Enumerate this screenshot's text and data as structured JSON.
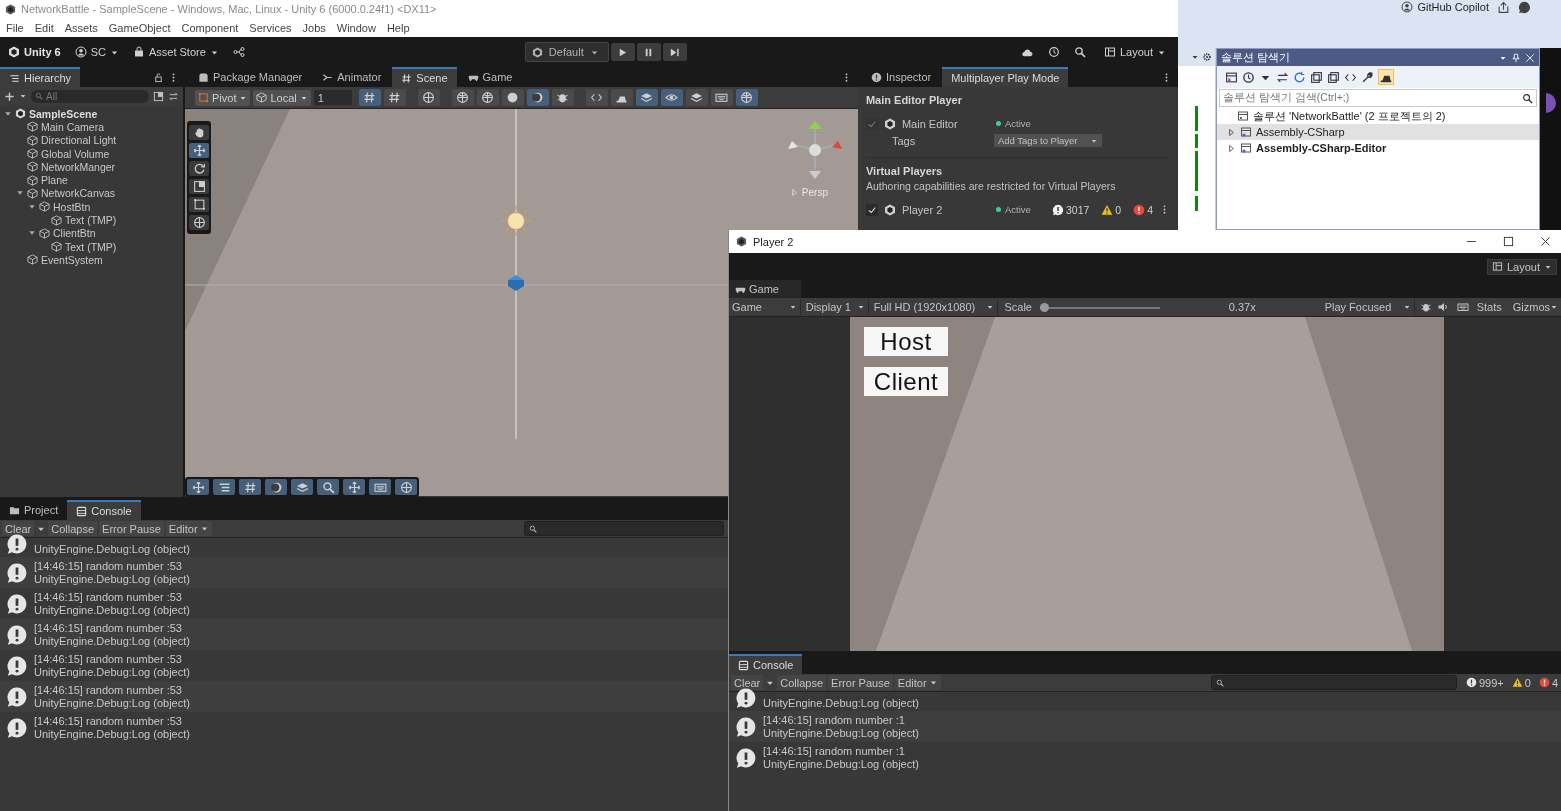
{
  "editor": {
    "title": "NetworkBattle - SampleScene - Windows, Mac, Linux - Unity 6 (6000.0.24f1) <DX11>",
    "menu": [
      "File",
      "Edit",
      "Assets",
      "GameObject",
      "Component",
      "Services",
      "Jobs",
      "Window",
      "Help"
    ],
    "toolbar": {
      "brand": "Unity 6",
      "account": "SC",
      "asset_store": "Asset Store",
      "play_mode": "Default",
      "layout": "Layout"
    },
    "hierarchy": {
      "tab": "Hierarchy",
      "search_placeholder": "All",
      "items": [
        {
          "label": "SampleScene",
          "kind": "scene",
          "expanded": true,
          "children": [
            {
              "label": "Main Camera",
              "kind": "object"
            },
            {
              "label": "Directional Light",
              "kind": "object"
            },
            {
              "label": "Global Volume",
              "kind": "object"
            },
            {
              "label": "NetworkManger",
              "kind": "object"
            },
            {
              "label": "Plane",
              "kind": "object"
            },
            {
              "label": "NetworkCanvas",
              "kind": "object",
              "expanded": true,
              "children": [
                {
                  "label": "HostBtn",
                  "kind": "object",
                  "expanded": true,
                  "children": [
                    {
                      "label": "Text (TMP)",
                      "kind": "object"
                    }
                  ]
                },
                {
                  "label": "ClientBtn",
                  "kind": "object",
                  "expanded": true,
                  "children": [
                    {
                      "label": "Text (TMP)",
                      "kind": "object"
                    }
                  ]
                }
              ]
            },
            {
              "label": "EventSystem",
              "kind": "object"
            }
          ]
        }
      ]
    },
    "center_tabs": [
      {
        "label": "Package Manager",
        "kind": "package",
        "selected": false
      },
      {
        "label": "Animator",
        "kind": "animator",
        "selected": false
      },
      {
        "label": "Scene",
        "kind": "scene",
        "selected": true
      },
      {
        "label": "Game",
        "kind": "game",
        "selected": false
      }
    ],
    "scene_toolbar": {
      "pivot": "Pivot",
      "space": "Local",
      "grid_size": "1"
    },
    "scene_view": {
      "projection": "Persp"
    },
    "inspector": {
      "tabs": [
        {
          "label": "Inspector",
          "kind": "inspector",
          "selected": false
        },
        {
          "label": "Multiplayer Play Mode",
          "kind": "plain",
          "selected": true
        }
      ],
      "main_heading": "Main Editor Player",
      "main_player": {
        "name": "Main Editor",
        "checked": true,
        "disabled": true,
        "status": "Active",
        "tags_label": "Tags",
        "tags_placeholder": "Add Tags to Player"
      },
      "virtual_heading": "Virtual Players",
      "virtual_note": "Authoring capabilities are restricted for Virtual Players",
      "virtual_players": [
        {
          "name": "Player 2",
          "checked": true,
          "disabled": false,
          "status": "Active",
          "logs": "3017",
          "warnings": "0",
          "errors": "4"
        }
      ]
    },
    "console": {
      "tabs": [
        {
          "label": "Project",
          "kind": "project",
          "selected": false
        },
        {
          "label": "Console",
          "kind": "console",
          "selected": true
        }
      ],
      "buttons": [
        {
          "label": "Clear",
          "kind": "split"
        },
        {
          "label": "Collapse",
          "kind": "toggle"
        },
        {
          "label": "Error Pause",
          "kind": "toggle"
        },
        {
          "label": "Editor",
          "kind": "dropdown"
        }
      ],
      "entries": [
        {
          "trace": "UnityEngine.Debug:Log (object)"
        },
        {
          "message": "[14:46:15] random number :53",
          "trace": "UnityEngine.Debug:Log (object)"
        },
        {
          "message": "[14:46:15] random number :53",
          "trace": "UnityEngine.Debug:Log (object)"
        },
        {
          "message": "[14:46:15] random number :53",
          "trace": "UnityEngine.Debug:Log (object)"
        },
        {
          "message": "[14:46:15] random number :53",
          "trace": "UnityEngine.Debug:Log (object)"
        },
        {
          "message": "[14:46:15] random number :53",
          "trace": "UnityEngine.Debug:Log (object)"
        },
        {
          "message": "[14:46:15] random number :53",
          "trace": "UnityEngine.Debug:Log (object)"
        }
      ]
    }
  },
  "solution_explorer": {
    "copilot": "GitHub Copilot",
    "title": "솔루션 탐색기",
    "search_placeholder": "솔루션 탐색기 검색(Ctrl+;)",
    "solution": "솔루션 'NetworkBattle'  (2 프로젝트의 2)",
    "projects": [
      {
        "label": "Assembly-CSharp",
        "selected": true,
        "startup": false
      },
      {
        "label": "Assembly-CSharp-Editor",
        "selected": false,
        "startup": true
      }
    ]
  },
  "player_window": {
    "title": "Player 2",
    "layout": "Layout",
    "tab": "Game",
    "toolbar": {
      "view": "Game",
      "display": "Display 1",
      "resolution": "Full HD (1920x1080)",
      "scale_label": "Scale",
      "scale": {
        "level": 0
      },
      "scale_value": "0.37x",
      "play_focus": "Play Focused",
      "stats": "Stats",
      "gizmos": "Gizmos"
    },
    "game_buttons": [
      "Host",
      "Client"
    ],
    "console": {
      "tabs": [
        {
          "label": "Console",
          "kind": "console",
          "selected": true
        }
      ],
      "buttons": [
        {
          "label": "Clear",
          "kind": "split"
        },
        {
          "label": "Collapse",
          "kind": "toggle"
        },
        {
          "label": "Error Pause",
          "kind": "toggle"
        },
        {
          "label": "Editor",
          "kind": "dropdown"
        }
      ],
      "counts": {
        "logs": "999+",
        "warnings": "0",
        "errors": "4"
      },
      "entries": [
        {
          "trace": "UnityEngine.Debug:Log (object)"
        },
        {
          "message": "[14:46:15] random number :1",
          "trace": "UnityEngine.Debug:Log (object)"
        },
        {
          "message": "[14:46:15] random number :1",
          "trace": "UnityEngine.Debug:Log (object)"
        }
      ]
    }
  }
}
